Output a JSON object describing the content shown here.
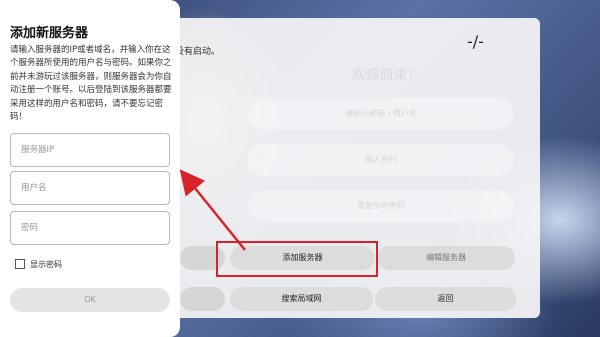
{
  "login_screen": {
    "hint_text": "没有启动。",
    "corner_mark": "-/-",
    "welcome": "欢迎回来!",
    "field_placeholders": [
      "请输入邮箱 / 用户名",
      "输入密码",
      "重复你的密码"
    ],
    "buttons": {
      "add_server": "添加服务器",
      "edit_server": "编辑服务器",
      "probe_lan": "搜索局域网",
      "back": "返回"
    }
  },
  "dialog": {
    "title": "添加新服务器",
    "description": "请输入服务器的IP或者域名，并输入你在这个服务器所使用的用户名与密码。如果你之前并未游玩过该服务器，则服务器会为你自动注册一个账号。以后登陆到该服务器都要采用这样的用户名和密码，请不要忘记密码！",
    "server_ip_placeholder": "服务器IP",
    "username_placeholder": "用户名",
    "password_placeholder": "密码",
    "show_password_label": "显示密码",
    "show_password_checked": false,
    "ok_label": "OK"
  },
  "annotation_color": "#d9232a"
}
